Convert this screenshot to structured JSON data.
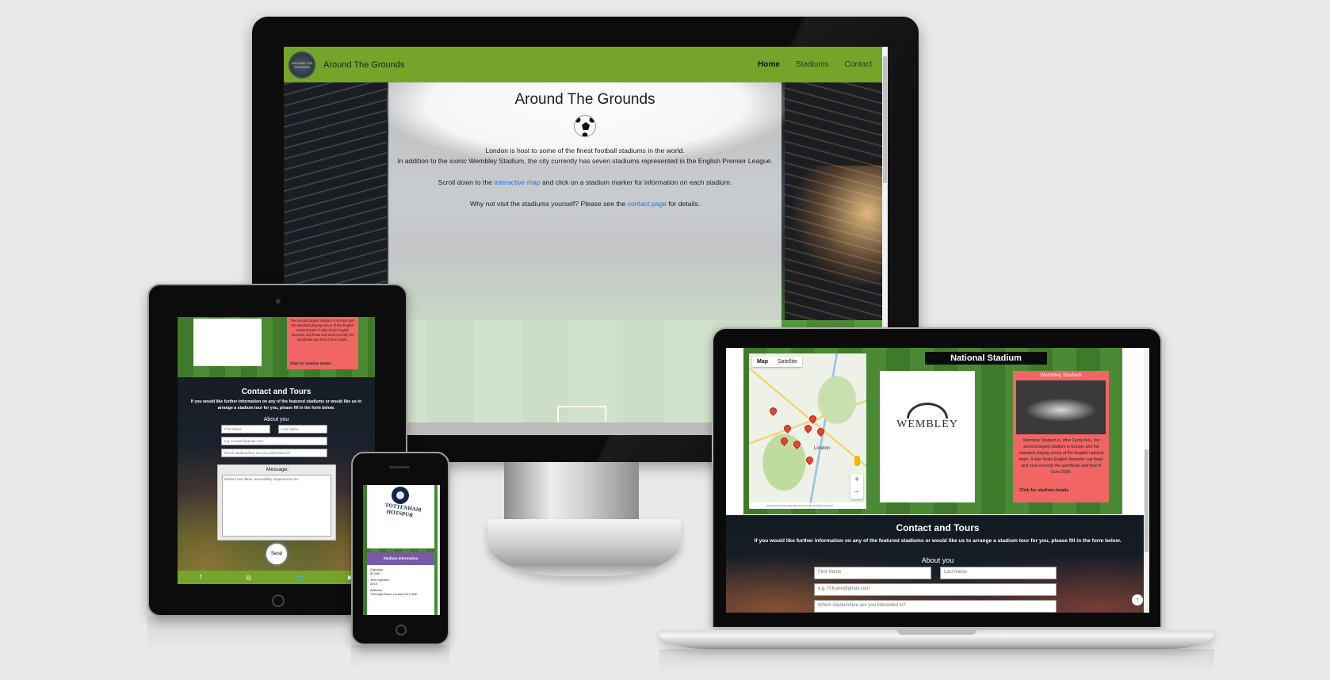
{
  "desktop": {
    "brand": "Around The Grounds",
    "logo_text": "AROUND THE GROUNDS",
    "nav": [
      "Home",
      "Stadiums",
      "Contact"
    ],
    "hero_title": "Around The Grounds",
    "line1": "London is host to some of the finest football stadiums in the world.",
    "line2": "In addition to the iconic Wembley Stadium, the city currently has seven stadiums represented in the English Premier League.",
    "line3_pre": "Scroll down to the ",
    "line3_link": "interactive map",
    "line3_post": " and click on a stadium marker for information on each stadium.",
    "line4_pre": "Why not visit the stadiums yourself? Please see the ",
    "line4_link": "contact page",
    "line4_post": " for details."
  },
  "tablet": {
    "red_text": "the second largest stadium in Europe and the standard playing venue of the English national team. It also hosts English domestic cup finals and most recently the semifinals and final of Euro 2020.",
    "red_cta": "Click for stadium details",
    "contact_title": "Contact and Tours",
    "contact_sub": "If you would like further information on any of the featured stadiums or would like us to arrange a stadium tour for you, please fill in the form below.",
    "about": "About you",
    "first": "First Name",
    "last": "Last Name",
    "email": "e.g. H.Kane@gmail.com",
    "select": "Which stadium/tour are you interested in?",
    "message_label": "Message:",
    "message_ph": "Desired tour dates, accessibility requirements etc.",
    "send": "Send",
    "social": [
      "f",
      "◎",
      "🐦",
      "▶"
    ]
  },
  "phone": {
    "crest_text": "TOTTENHAM HOTSPUR",
    "info_header": "Stadium Information",
    "capacity_label": "Capacity:",
    "capacity": "62,850",
    "opened_label": "Year Opened:",
    "opened": "2019",
    "address_label": "Address:",
    "address": "748 High Road, London N17 0AP"
  },
  "laptop": {
    "map_tabs": [
      "Map",
      "Satellite"
    ],
    "map_attr": "Keyboard shortcuts   Map Data   Terms of Use   Report a map error",
    "map_city": "London",
    "national_label": "National Stadium",
    "wembley_logo": "WEMBLEY",
    "red_title": "Wembley Stadium",
    "red_text": "Wembley Stadium is, after Camp Nou, the second largest stadium in Europe and the standard playing venue of the English national team. It also hosts English domestic cup finals and most recently the semifinals and final of Euro 2020.",
    "red_cta": "Click for stadium details",
    "contact_title": "Contact and Tours",
    "contact_sub": "If you would like further information on any of the featured stadiums or would like us to arrange a stadium tour for you, please fill in the form below.",
    "about": "About you",
    "first": "First Name",
    "last": "Last Name",
    "email": "e.g. H.Kane@gmail.com",
    "select": "Which stadium/tour are you interested in?",
    "up": "↑"
  }
}
